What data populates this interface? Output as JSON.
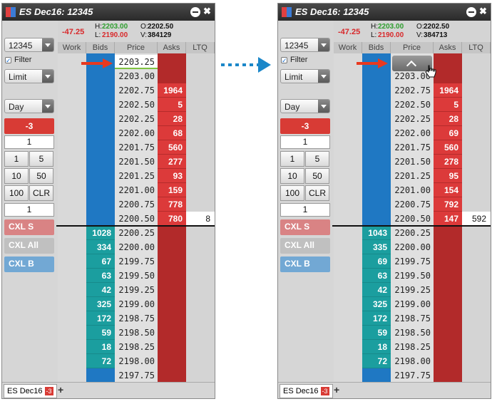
{
  "panels": [
    {
      "title": "ES Dec16: 12345",
      "pnl": "-47.25",
      "high_label": "H:",
      "high": "2203.00",
      "low_label": "L:",
      "low": "2190.00",
      "open_label": "O:",
      "open": "2202.50",
      "vol_label": "V:",
      "volume": "384129",
      "account": "12345",
      "filter_label": "Filter",
      "order_type": "Limit",
      "tif": "Day",
      "position": "-3",
      "qty": "1",
      "qty_buttons": [
        "1",
        "5",
        "10",
        "50",
        "100",
        "CLR"
      ],
      "qty2": "1",
      "cxl_s": "CXL S",
      "cxl_all": "CXL All",
      "cxl_b": "CXL B",
      "headers": [
        "Work",
        "Bids",
        "Price",
        "Asks",
        "LTQ"
      ],
      "prices": [
        "2203.25",
        "2203.00",
        "2202.75",
        "2202.50",
        "2202.25",
        "2202.00",
        "2201.75",
        "2201.50",
        "2201.25",
        "2201.00",
        "2200.75",
        "2200.50",
        "2200.25",
        "2200.00",
        "2199.75",
        "2199.50",
        "2199.25",
        "2199.00",
        "2198.75",
        "2198.50",
        "2198.25",
        "2198.00",
        "2197.75"
      ],
      "asks": [
        "",
        "",
        "1964",
        "5",
        "28",
        "68",
        "560",
        "277",
        "93",
        "159",
        "778",
        "780",
        "",
        "",
        "",
        "",
        "",
        "",
        "",
        "",
        "",
        "",
        ""
      ],
      "bids": [
        "",
        "",
        "",
        "",
        "",
        "",
        "",
        "",
        "",
        "",
        "",
        "",
        "1028",
        "334",
        "67",
        "63",
        "42",
        "325",
        "172",
        "59",
        "18",
        "72",
        ""
      ],
      "ltq": [
        "",
        "",
        "",
        "",
        "",
        "",
        "",
        "",
        "",
        "",
        "",
        "8",
        "",
        "",
        "",
        "",
        "",
        "",
        "",
        "",
        "",
        "",
        ""
      ],
      "tab_label": "ES Dec16",
      "tab_badge": "-3",
      "scroll_button": false
    },
    {
      "title": "ES Dec16: 12345",
      "pnl": "-47.25",
      "high_label": "H:",
      "high": "2203.00",
      "low_label": "L:",
      "low": "2190.00",
      "open_label": "O:",
      "open": "2202.50",
      "vol_label": "V:",
      "volume": "384713",
      "account": "12345",
      "filter_label": "Filter",
      "order_type": "Limit",
      "tif": "Day",
      "position": "-3",
      "qty": "1",
      "qty_buttons": [
        "1",
        "5",
        "10",
        "50",
        "100",
        "CLR"
      ],
      "qty2": "1",
      "cxl_s": "CXL S",
      "cxl_all": "CXL All",
      "cxl_b": "CXL B",
      "headers": [
        "Work",
        "Bids",
        "Price",
        "Asks",
        "LTQ"
      ],
      "prices": [
        "",
        "2203.00",
        "2202.75",
        "2202.50",
        "2202.25",
        "2202.00",
        "2201.75",
        "2201.50",
        "2201.25",
        "2201.00",
        "2200.75",
        "2200.50",
        "2200.25",
        "2200.00",
        "2199.75",
        "2199.50",
        "2199.25",
        "2199.00",
        "2198.75",
        "2198.50",
        "2198.25",
        "2198.00",
        "2197.75"
      ],
      "asks": [
        "",
        "",
        "1964",
        "5",
        "28",
        "69",
        "560",
        "278",
        "95",
        "154",
        "792",
        "147",
        "",
        "",
        "",
        "",
        "",
        "",
        "",
        "",
        "",
        "",
        ""
      ],
      "bids": [
        "",
        "",
        "",
        "",
        "",
        "",
        "",
        "",
        "",
        "",
        "",
        "",
        "1043",
        "335",
        "69",
        "63",
        "42",
        "325",
        "172",
        "59",
        "18",
        "72",
        ""
      ],
      "ltq": [
        "",
        "",
        "",
        "",
        "",
        "",
        "",
        "",
        "",
        "",
        "",
        "592",
        "",
        "",
        "",
        "",
        "",
        "",
        "",
        "",
        "",
        "",
        ""
      ],
      "tab_label": "ES Dec16",
      "tab_badge": "-3",
      "scroll_button": true
    }
  ],
  "colors": {
    "bid": "#1f78c3",
    "bid_cell": "#1b9e9f",
    "ask": "#b22a2a",
    "ask_cell": "#dc3a3a",
    "arrow": "#e8391f",
    "connector": "#1b87c9"
  }
}
